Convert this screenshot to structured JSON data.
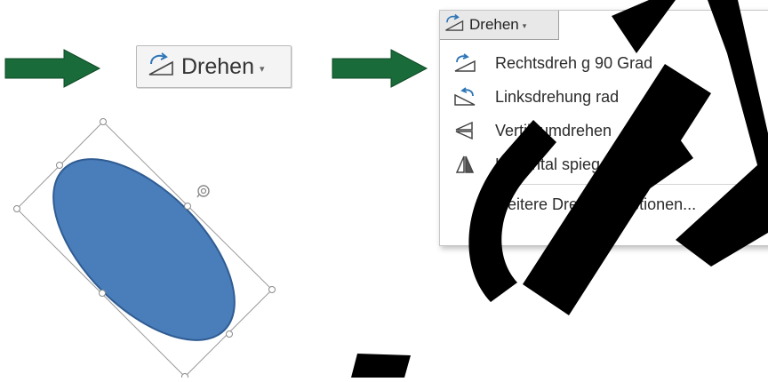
{
  "button": {
    "label": "Drehen",
    "caret": "▾",
    "icon": "rotate-icon"
  },
  "menu": {
    "header_label": "Drehen",
    "header_caret": "▾",
    "items": [
      {
        "label": "Rechtsdreh g 90 Grad",
        "icon": "rotate-right-icon"
      },
      {
        "label": "Linksdrehung rad",
        "icon": "rotate-left-icon"
      },
      {
        "label": "Vertik umdrehen",
        "icon": "flip-vertical-icon"
      },
      {
        "label": "Hi zontal spiegeln",
        "icon": "flip-horizontal-icon"
      }
    ],
    "more_label": "eitere Drehungsoptionen..."
  },
  "colors": {
    "arrow": "#1a6b3a",
    "ellipse": "#4a7ebb",
    "ellipse_stroke": "#2f5c92",
    "icon_blue": "#2e75b6",
    "watermark": "#000000"
  }
}
